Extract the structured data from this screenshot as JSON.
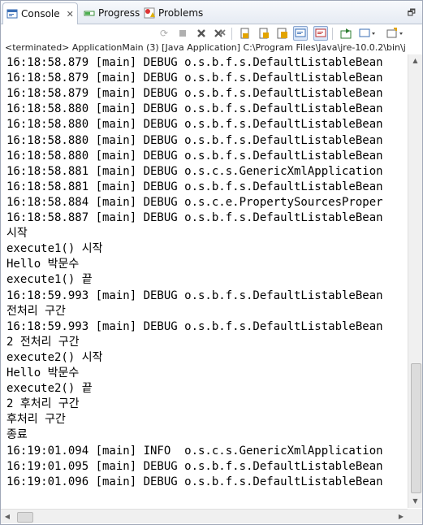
{
  "tabs": [
    {
      "label": "Console",
      "active": true,
      "icon": "console-icon",
      "closable": true
    },
    {
      "label": "Progress",
      "active": false,
      "icon": "progress-icon"
    },
    {
      "label": "Problems",
      "active": false,
      "icon": "problems-icon"
    }
  ],
  "toolbar": {
    "buttons": [
      "pin-console-icon",
      "terminate-icon",
      "remove-launch-icon",
      "remove-all-terminated-icon",
      "scroll-lock-icon",
      "word-wrap-icon",
      "show-console-stdout-icon",
      "show-console-stderr-icon",
      "open-console-icon",
      "display-selected-console-icon",
      "new-console-icon"
    ]
  },
  "status": "<terminated> ApplicationMain (3) [Java Application] C:\\Program Files\\Java\\jre-10.0.2\\bin\\j",
  "console_lines": [
    "16:18:58.879 [main] DEBUG o.s.b.f.s.DefaultListableBean",
    "16:18:58.879 [main] DEBUG o.s.b.f.s.DefaultListableBean",
    "16:18:58.879 [main] DEBUG o.s.b.f.s.DefaultListableBean",
    "16:18:58.880 [main] DEBUG o.s.b.f.s.DefaultListableBean",
    "16:18:58.880 [main] DEBUG o.s.b.f.s.DefaultListableBean",
    "16:18:58.880 [main] DEBUG o.s.b.f.s.DefaultListableBean",
    "16:18:58.880 [main] DEBUG o.s.b.f.s.DefaultListableBean",
    "16:18:58.881 [main] DEBUG o.s.c.s.GenericXmlApplication",
    "16:18:58.881 [main] DEBUG o.s.b.f.s.DefaultListableBean",
    "16:18:58.884 [main] DEBUG o.s.c.e.PropertySourcesProper",
    "16:18:58.887 [main] DEBUG o.s.b.f.s.DefaultListableBean",
    "시작",
    "execute1() 시작",
    "Hello 박문수",
    "execute1() 끝",
    "16:18:59.993 [main] DEBUG o.s.b.f.s.DefaultListableBean",
    "전처리 구간",
    "16:18:59.993 [main] DEBUG o.s.b.f.s.DefaultListableBean",
    "2 전처리 구간",
    "execute2() 시작",
    "Hello 박문수",
    "execute2() 끝",
    "2 후처리 구간",
    "후처리 구간",
    "종료",
    "16:19:01.094 [main] INFO  o.s.c.s.GenericXmlApplication",
    "16:19:01.095 [main] DEBUG o.s.b.f.s.DefaultListableBean",
    "16:19:01.096 [main] DEBUG o.s.b.f.s.DefaultListableBean"
  ],
  "colors": {
    "accent": "#3b6fb6",
    "tab_border": "#b9c2d1",
    "text": "#000000"
  }
}
